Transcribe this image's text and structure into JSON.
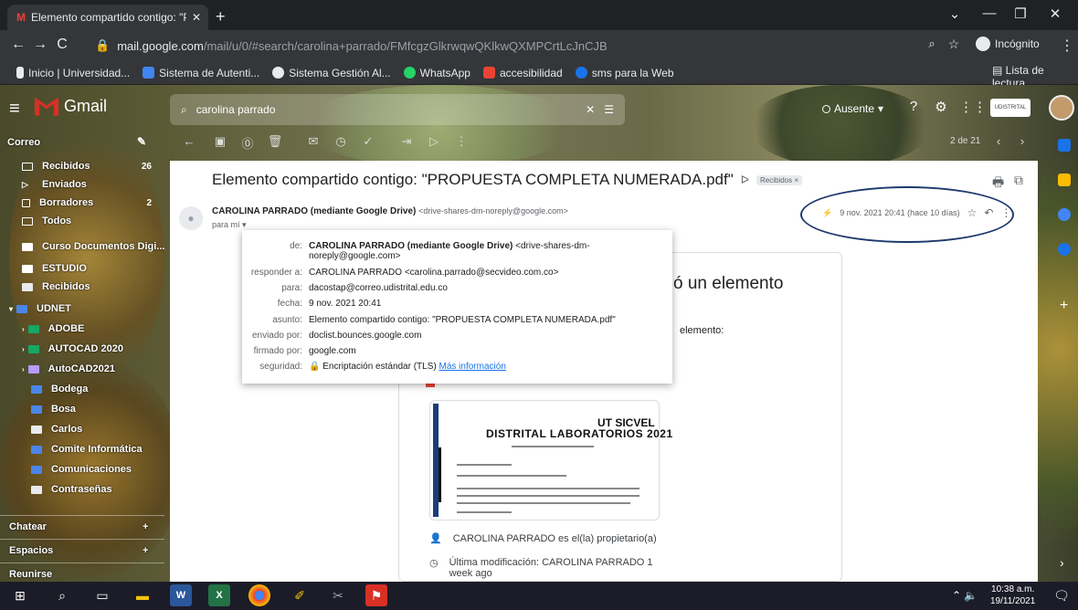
{
  "browser": {
    "tab_title": "Elemento compartido contigo: \"P",
    "url_host": "mail.google.com",
    "url_path": "/mail/u/0/#search/carolina+parrado/FMfcgzGlkrwqwQKlkwQXMPCrtLcJnCJB",
    "incognito_label": "Incógnito",
    "bookmarks": [
      {
        "label": "Inicio | Universidad...",
        "icon": "udistrital-icon",
        "color": "#e8eaed"
      },
      {
        "label": "Sistema de Autenti...",
        "icon": "auth-icon",
        "color": "#4285f4"
      },
      {
        "label": "Sistema Gestión Al...",
        "icon": "globe-icon",
        "color": "#e8eaed"
      },
      {
        "label": "WhatsApp",
        "icon": "whatsapp-icon",
        "color": "#25d366"
      },
      {
        "label": "accesibilidad",
        "icon": "accessibility-icon",
        "color": "#ea4335"
      },
      {
        "label": "sms para la Web",
        "icon": "sms-icon",
        "color": "#1a73e8"
      }
    ],
    "reading_list": "Lista de lectura"
  },
  "gmail": {
    "logo_text": "Gmail",
    "search_query": "carolina parrado",
    "status": "Ausente",
    "pager": "2 de 21",
    "sidebar": {
      "section_mail": "Correo",
      "items": [
        {
          "label": "Recibidos",
          "count": "26",
          "color": "#ffffff"
        },
        {
          "label": "Enviados",
          "count": "",
          "color": "#ffffff"
        },
        {
          "label": "Borradores",
          "count": "2",
          "color": "#ffffff"
        },
        {
          "label": "Todos",
          "count": "",
          "color": "#ffffff"
        },
        {
          "label": "Curso Documentos Digi...",
          "count": "",
          "color": "#ffffff"
        },
        {
          "label": "ESTUDIO",
          "count": "",
          "color": "#ffffff"
        },
        {
          "label": "Recibidos",
          "count": "",
          "color": "#e8eaed"
        },
        {
          "label": "UDNET",
          "count": "",
          "color": "#4a86e8"
        },
        {
          "label": "ADOBE",
          "count": "",
          "color": "#16a765"
        },
        {
          "label": "AUTOCAD 2020",
          "count": "",
          "color": "#16a765"
        },
        {
          "label": "AutoCAD2021",
          "count": "",
          "color": "#b99aff"
        },
        {
          "label": "Bodega",
          "count": "",
          "color": "#4a86e8"
        },
        {
          "label": "Bosa",
          "count": "",
          "color": "#4a86e8"
        },
        {
          "label": "Carlos",
          "count": "",
          "color": "#e8eaed"
        },
        {
          "label": "Comite Informática",
          "count": "",
          "color": "#4a86e8"
        },
        {
          "label": "Comunicaciones",
          "count": "",
          "color": "#4a86e8"
        },
        {
          "label": "Contraseñas",
          "count": "",
          "color": "#e8eaed"
        }
      ],
      "section_chat": "Chatear",
      "section_spaces": "Espacios",
      "section_meet": "Reunirse"
    },
    "email": {
      "subject": "Elemento compartido contigo: \"PROPUESTA COMPLETA NUMERADA.pdf\"",
      "label_chip": "Recibidos ×",
      "sender_name": "CAROLINA PARRADO (mediante Google Drive)",
      "sender_email": "<drive-shares-dm-noreply@google.com>",
      "to_me": "para mí ▾",
      "date": "9 nov. 2021 20:41 (hace 10 días)"
    },
    "details": {
      "rows": [
        {
          "k": "de:",
          "v_bold": "CAROLINA PARRADO (mediante Google Drive)",
          "v": " <drive-shares-dm-noreply@google.com>"
        },
        {
          "k": "responder a:",
          "v_bold": "",
          "v": "CAROLINA PARRADO <carolina.parrado@secvideo.com.co>"
        },
        {
          "k": "para:",
          "v_bold": "",
          "v": "dacostap@correo.udistrital.edu.co"
        },
        {
          "k": "fecha:",
          "v_bold": "",
          "v": "9 nov. 2021 20:41"
        },
        {
          "k": "asunto:",
          "v_bold": "",
          "v": "Elemento compartido contigo: \"PROPUESTA COMPLETA NUMERADA.pdf\""
        },
        {
          "k": "enviado por:",
          "v_bold": "",
          "v": "doclist.bounces.google.com"
        },
        {
          "k": "firmado por:",
          "v_bold": "",
          "v": "google.com"
        }
      ],
      "security_key": "seguridad:",
      "security_value": "🔒 Encriptación estándar (TLS)",
      "security_link": "Más información"
    },
    "share_card": {
      "headline": "ó un elemento",
      "element_text": "elemento:",
      "doc_title_1": "UT SICVEL",
      "doc_title_2": "DISTRITAL LABORATORIOS 2021",
      "owner_text": "CAROLINA PARRADO es el(la) propietario(a)",
      "modified_text": "Última modificación: CAROLINA PARRADO 1 week ago"
    }
  },
  "taskbar": {
    "time": "10:38 a.m.",
    "date": "19/11/2021"
  }
}
